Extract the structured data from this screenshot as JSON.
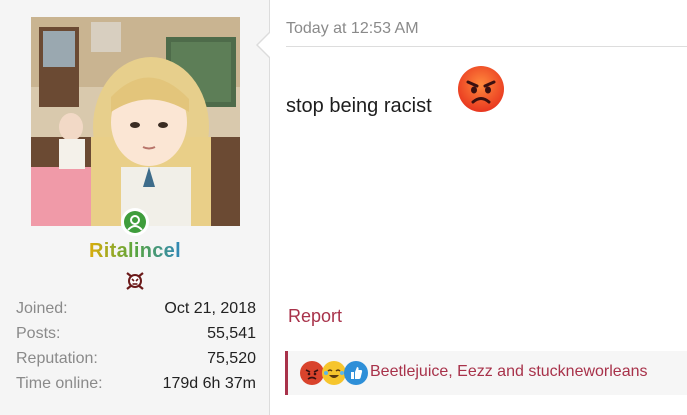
{
  "user": {
    "username": "Ritalincel",
    "avatar_icon": "anime-girl-avatar",
    "online_status_icon": "online-user-icon",
    "rank_icon": "angry-skull-icon",
    "stats": [
      {
        "label": "Joined:",
        "value": "Oct 21, 2018"
      },
      {
        "label": "Posts:",
        "value": "55,541"
      },
      {
        "label": "Reputation:",
        "value": "75,520"
      },
      {
        "label": "Time online:",
        "value": "179d 6h 37m"
      }
    ]
  },
  "post": {
    "date": "Today at 12:53 AM",
    "message": "stop being racist",
    "message_emoji": "angry-face-emoji",
    "report_label": "Report",
    "reactions_icons": [
      "angry-react-icon",
      "laugh-react-icon",
      "like-react-icon"
    ],
    "likes_text": "Beetlejuice, Eezz and stuckneworleans"
  },
  "colors": {
    "accent": "#a8324a",
    "online": "#3f9d3c",
    "muted": "#8a8a8a"
  }
}
